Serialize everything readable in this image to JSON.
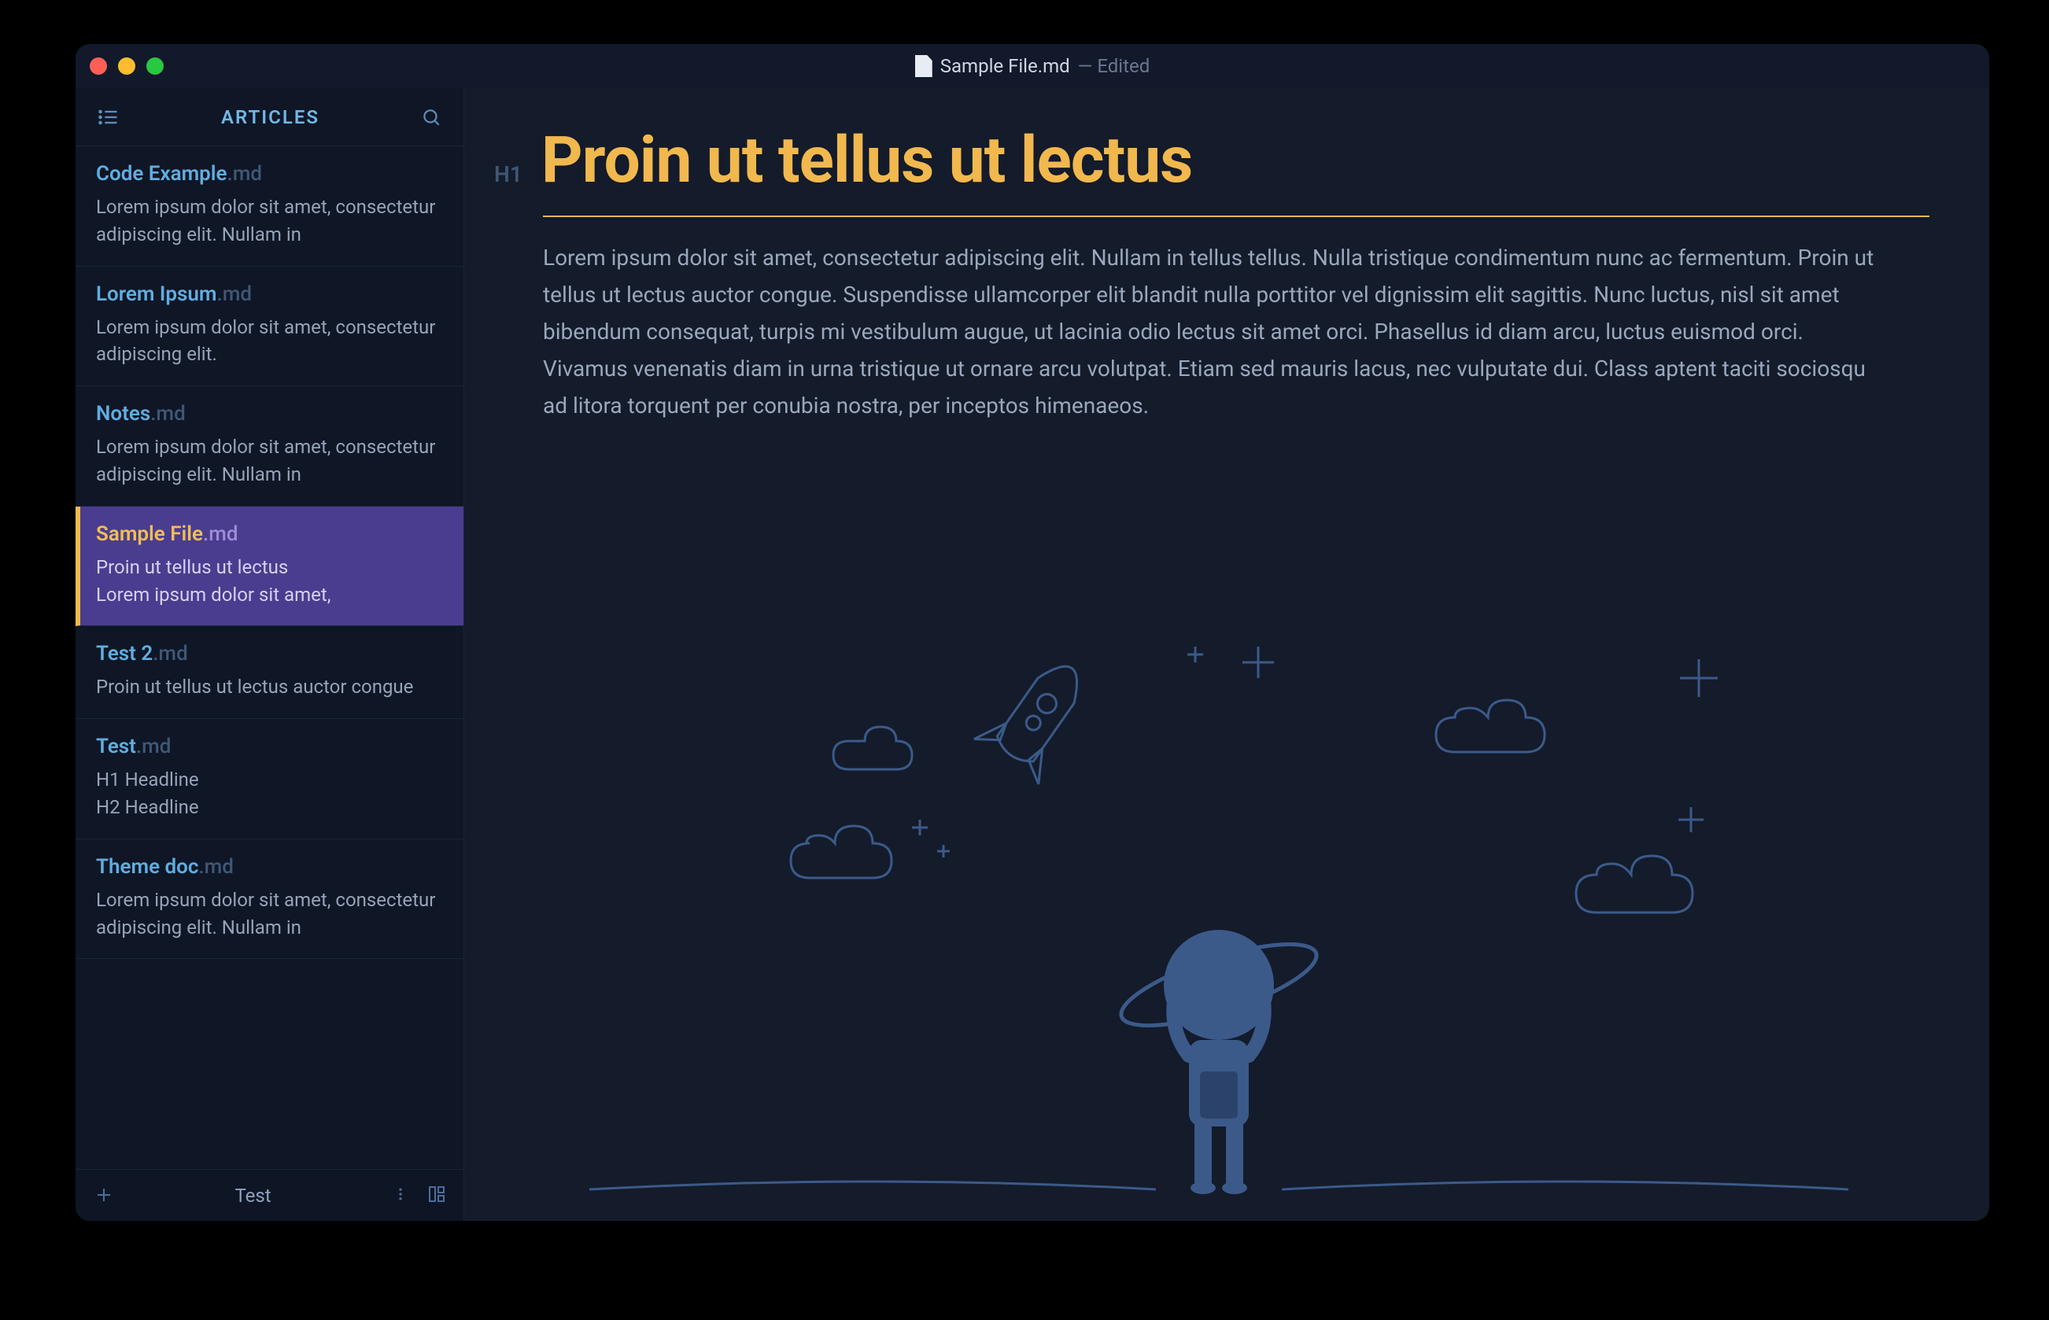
{
  "window": {
    "filename": "Sample File.md",
    "status": "— Edited"
  },
  "sidebar": {
    "title": "ARTICLES",
    "items": [
      {
        "name": "Code Example",
        "ext": ".md",
        "preview": "Lorem ipsum dolor sit amet, consectetur adipiscing elit. Nullam in",
        "active": false
      },
      {
        "name": "Lorem Ipsum",
        "ext": ".md",
        "preview": "Lorem ipsum dolor sit amet, consectetur adipiscing elit.",
        "active": false
      },
      {
        "name": "Notes",
        "ext": ".md",
        "preview": "Lorem ipsum dolor sit amet, consectetur adipiscing elit. Nullam in",
        "active": false
      },
      {
        "name": "Sample File",
        "ext": ".md",
        "preview": "Proin ut tellus ut lectus\nLorem ipsum dolor sit amet,",
        "active": true
      },
      {
        "name": "Test 2",
        "ext": ".md",
        "preview": "Proin ut tellus ut lectus auctor congue",
        "active": false
      },
      {
        "name": "Test",
        "ext": ".md",
        "preview": "H1 Headline\nH2 Headline",
        "active": false
      },
      {
        "name": "Theme doc",
        "ext": ".md",
        "preview": "Lorem ipsum dolor sit amet, consectetur adipiscing elit. Nullam in",
        "active": false
      }
    ],
    "footer_label": "Test"
  },
  "editor": {
    "h1_tag": "H1",
    "h1_text": "Proin ut tellus ut lectus",
    "paragraph": "Lorem ipsum dolor sit amet, consectetur adipiscing elit. Nullam in tellus tellus. Nulla tristique condimentum nunc ac fermentum. Proin ut tellus ut lectus auctor congue. Suspendisse ullamcorper elit blandit nulla porttitor vel dignissim elit sagittis. Nunc luctus, nisl sit amet bibendum consequat, turpis mi vestibulum augue, ut lacinia odio lectus sit amet orci. Phasellus id diam arcu, luctus euismod orci. Vivamus venenatis diam in urna tristique ut ornare arcu volutpat. Etiam sed mauris lacus, nec vulputate dui. Class aptent taciti sociosqu ad litora torquent per conubia nostra, per inceptos himenaeos."
  },
  "colors": {
    "accent": "#f1b84e",
    "link": "#5faee1",
    "active_bg": "#4a3d8f",
    "bg": "#141b2a",
    "sidebar_bg": "#0f1626"
  }
}
